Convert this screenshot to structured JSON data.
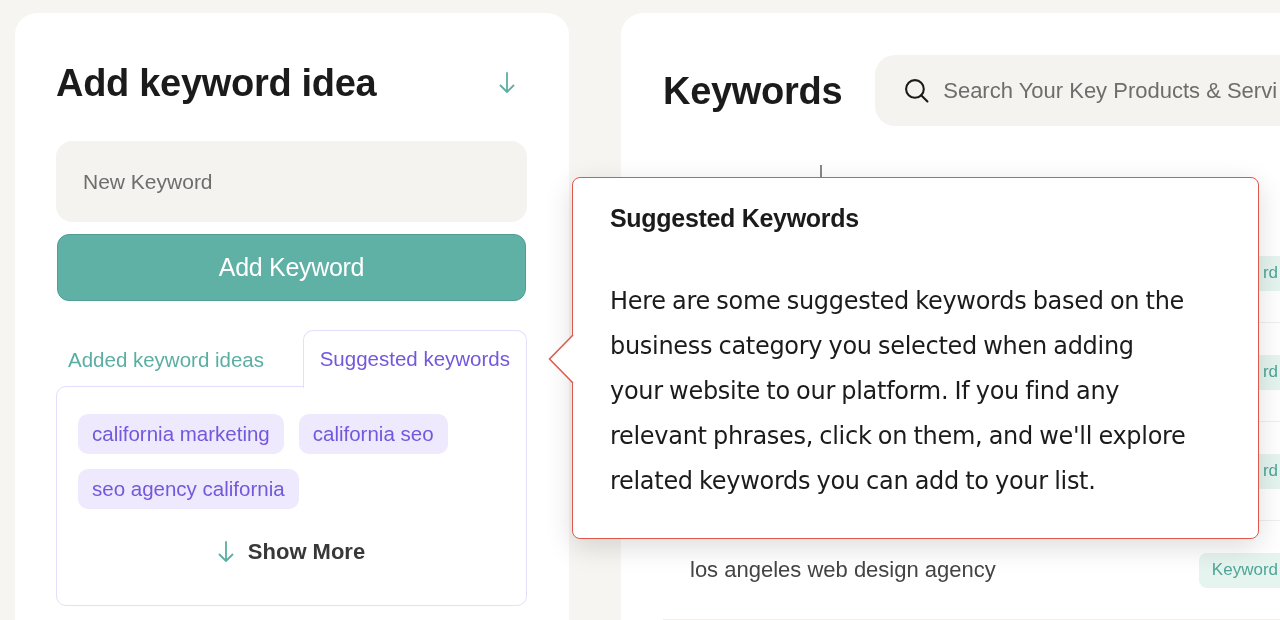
{
  "add_panel": {
    "title": "Add keyword idea",
    "keyword_field": {
      "placeholder": "New Keyword"
    },
    "add_button": "Add Keyword",
    "tabs": [
      {
        "label": "Added keyword ideas",
        "selected": false
      },
      {
        "label": "Suggested keywords",
        "selected": true
      }
    ],
    "suggestions": [
      "california marketing",
      "california seo",
      "seo agency california"
    ],
    "show_more": "Show More"
  },
  "keywords_panel": {
    "title": "Keywords",
    "search": {
      "placeholder": "Search Your Key Products & Servi"
    },
    "table": {
      "rows": [
        {
          "source": "rd"
        },
        {
          "source": "rd"
        },
        {
          "source": "rd"
        },
        {
          "keyword": "los angeles web design agency",
          "source": "Keyword"
        }
      ]
    }
  },
  "popover": {
    "title": "Suggested Keywords",
    "text": "Here are some suggested keywords based on the business category you selected when adding your website to our platform. If you find any relevant phrases, click on them, and we'll explore related keywords you can add to your list."
  }
}
